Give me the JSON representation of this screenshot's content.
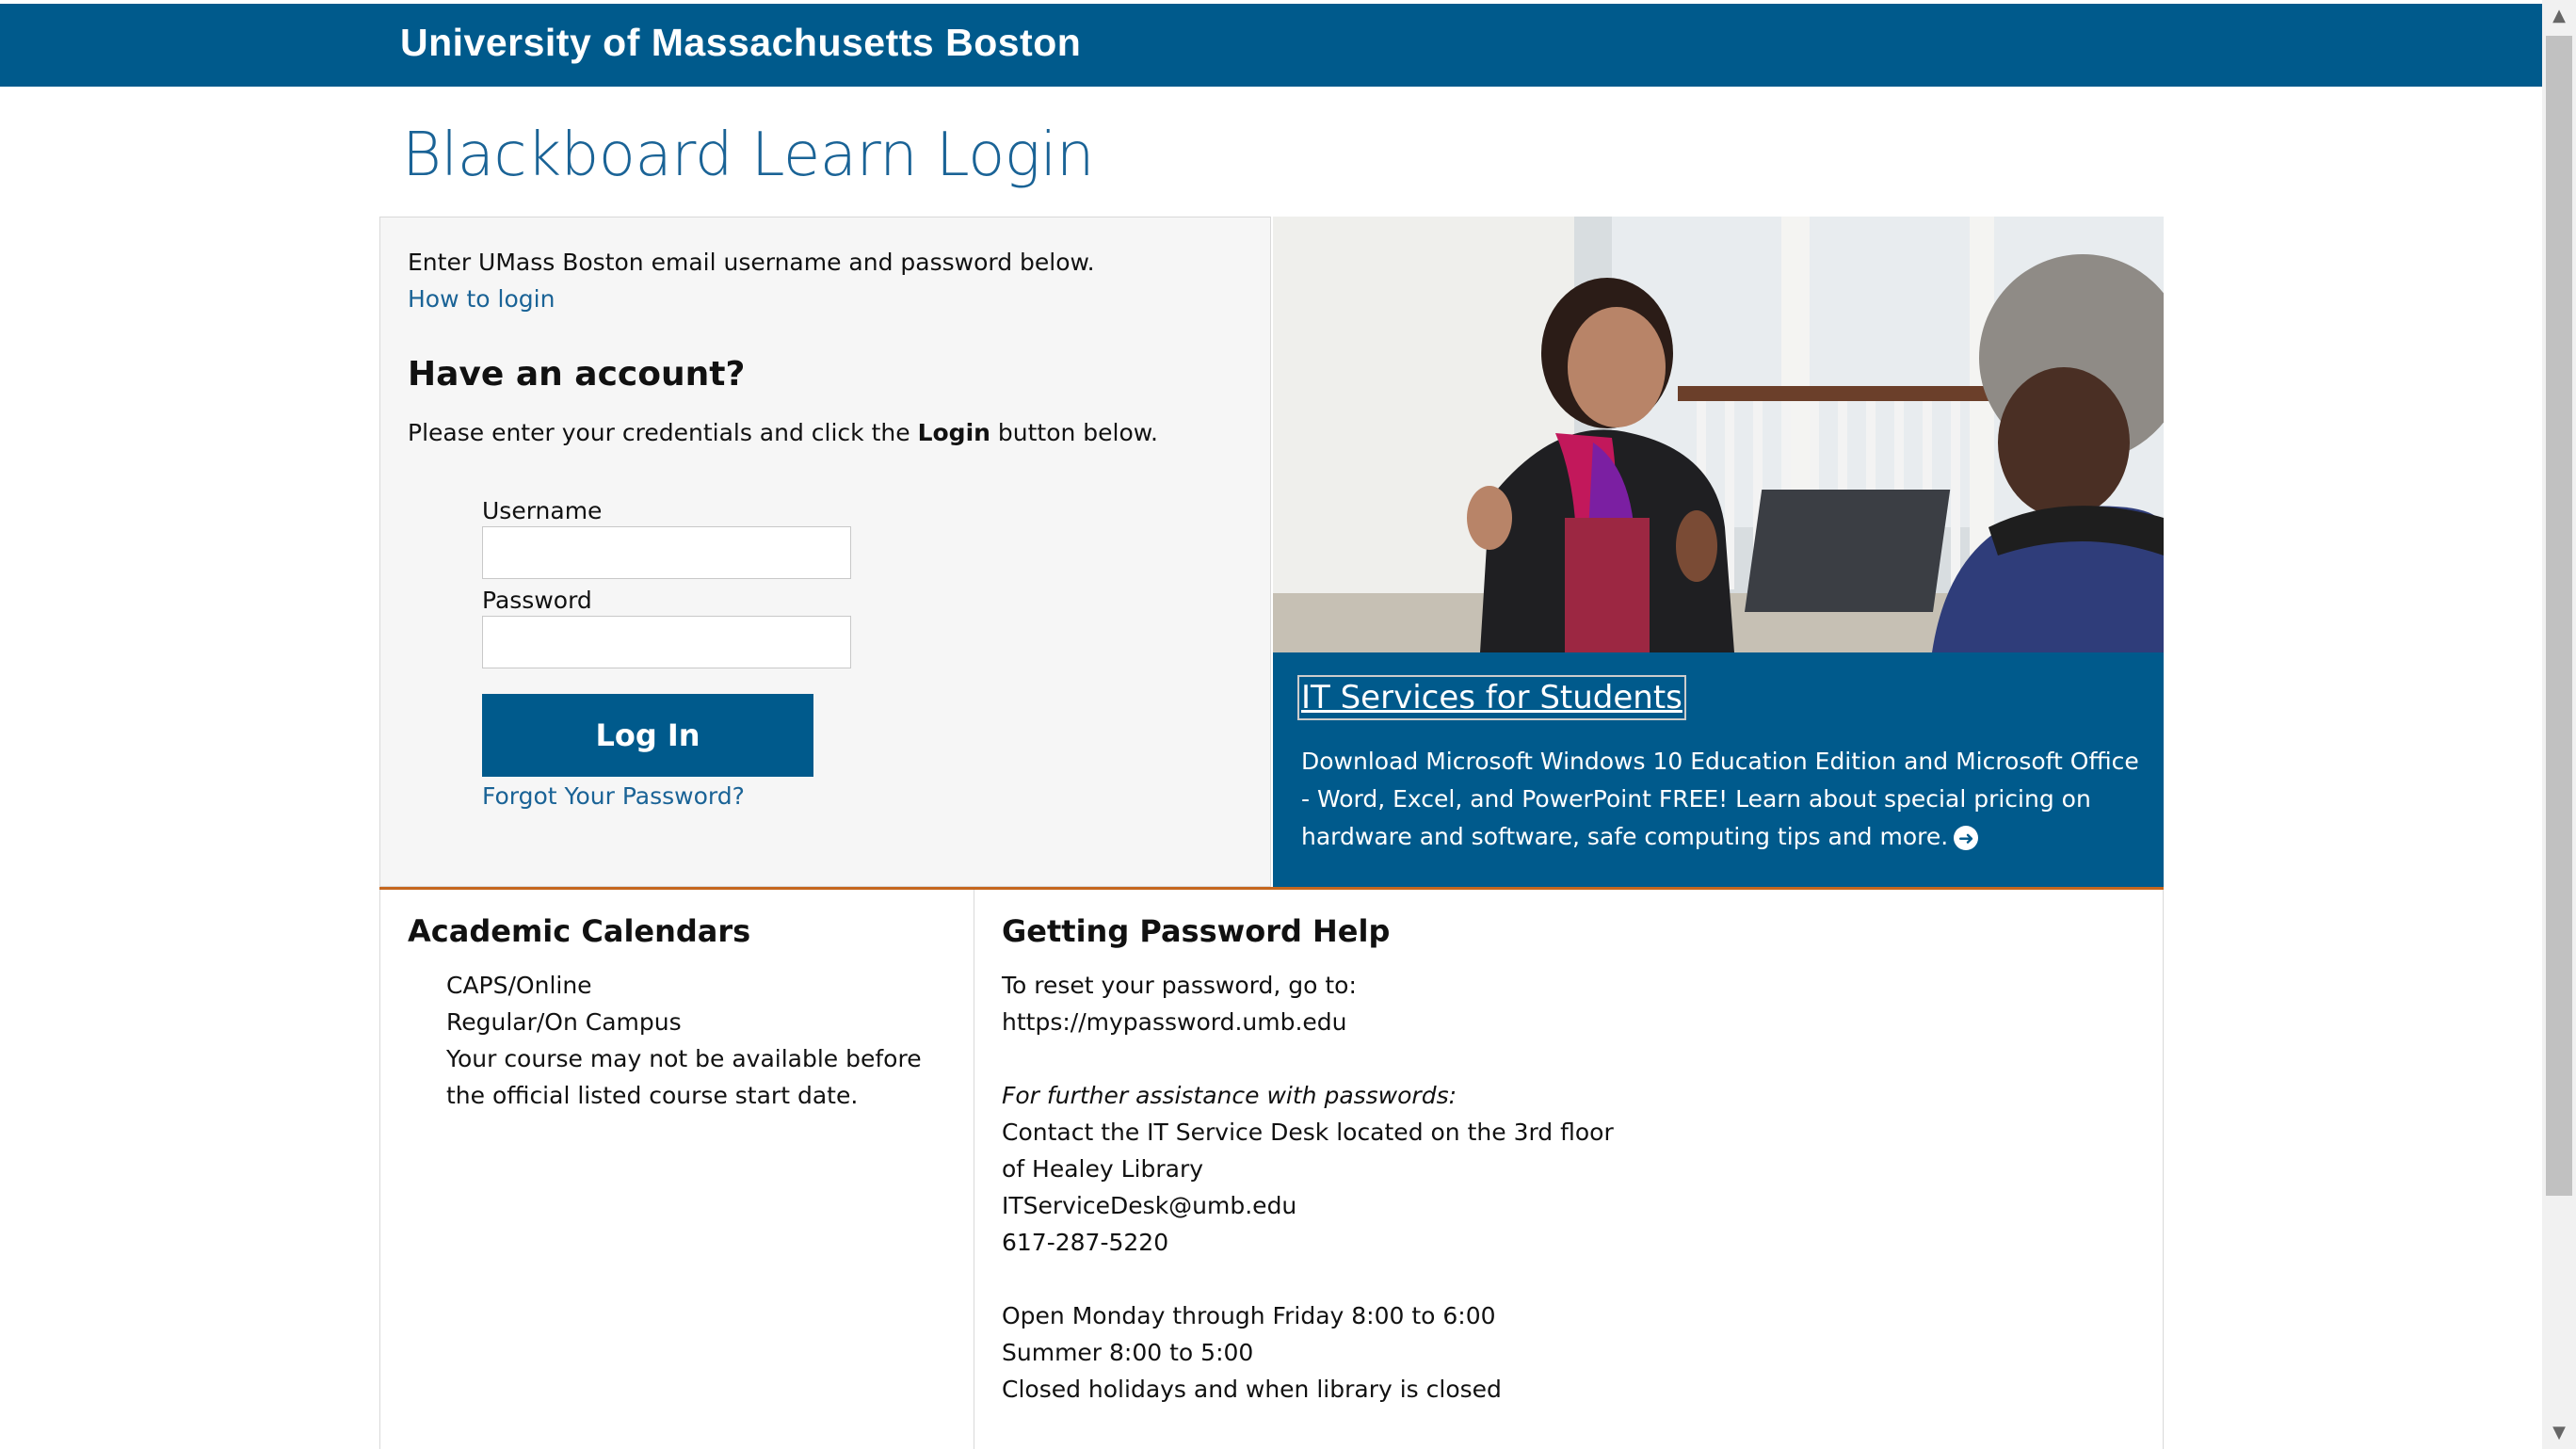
{
  "header": {
    "title": "University of Massachusetts Boston"
  },
  "page": {
    "title": "Blackboard Learn Login"
  },
  "login": {
    "intro": "Enter UMass Boston email username and password below.",
    "how_to_login": "How to login",
    "account_heading": "Have an account?",
    "instructions_before": "Please enter your credentials and click the ",
    "instructions_bold": "Login",
    "instructions_after": " button below.",
    "username_label": "Username",
    "username_value": "",
    "password_label": "Password",
    "password_value": "",
    "login_button": "Log In",
    "forgot_password": "Forgot Your Password?"
  },
  "promo": {
    "title": "IT Services for Students",
    "text": "Download Microsoft Windows 10 Education Edition and Microsoft Office - Word, Excel, and PowerPoint FREE! Learn about special pricing on hardware and software, safe computing tips and more."
  },
  "calendars": {
    "title": "Academic Calendars",
    "links": [
      "CAPS/Online",
      "Regular/On Campus"
    ],
    "note": "Your course may not be available before the official listed course start date."
  },
  "password_help": {
    "title": "Getting Password Help",
    "reset_text": "To reset your password, go to:",
    "reset_link": "https://mypassword.umb.edu",
    "assist_heading": "For further assistance with passwords:",
    "contact_line1": "Contact the IT Service Desk located on the 3rd floor",
    "contact_line2": "of Healey Library",
    "email": "ITServiceDesk@umb.edu",
    "phone": "617-287-5220",
    "hours1": "Open Monday through Friday 8:00 to 6:00",
    "hours2": "Summer 8:00 to 5:00",
    "hours3": "Closed holidays and when library is closed"
  },
  "colors": {
    "brand": "#005a8c",
    "accent": "#c5661e",
    "link": "#1a6396"
  }
}
